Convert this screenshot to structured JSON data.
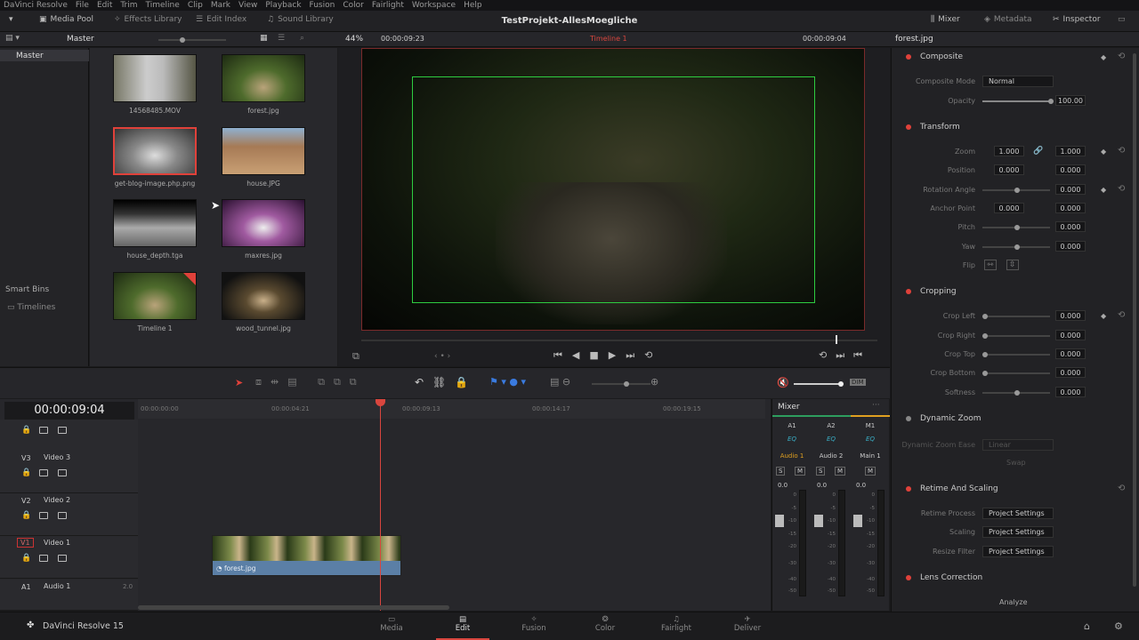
{
  "menu": [
    "DaVinci Resolve",
    "File",
    "Edit",
    "Trim",
    "Timeline",
    "Clip",
    "Mark",
    "View",
    "Playback",
    "Fusion",
    "Color",
    "Fairlight",
    "Workspace",
    "Help"
  ],
  "toolbar": {
    "media_pool": "Media Pool",
    "effects_library": "Effects Library",
    "edit_index": "Edit Index",
    "sound_library": "Sound Library",
    "project_title": "TestProjekt-AllesMoegliche",
    "mixer": "Mixer",
    "metadata": "Metadata",
    "inspector": "Inspector"
  },
  "subbar": {
    "bin": "Master",
    "zoom": "44%",
    "source_tc": "00:00:09:23",
    "timeline_name": "Timeline 1",
    "timeline_tc": "00:00:09:04",
    "clip_name": "forest.jpg"
  },
  "bins": {
    "master": "Master",
    "smart_bins": "Smart Bins",
    "timelines": "Timelines"
  },
  "clips": [
    {
      "name": "14568485.MOV"
    },
    {
      "name": "forest.jpg"
    },
    {
      "name": "get-blog-image.php.png",
      "selected": true
    },
    {
      "name": "house.JPG"
    },
    {
      "name": "house_depth.tga"
    },
    {
      "name": "maxres.jpg"
    },
    {
      "name": "Timeline 1"
    },
    {
      "name": "wood_tunnel.jpg"
    }
  ],
  "inspector": {
    "composite": {
      "title": "Composite",
      "mode_label": "Composite Mode",
      "mode": "Normal",
      "opacity_label": "Opacity",
      "opacity": "100.00",
      "opacity_fraction": 1.0
    },
    "transform": {
      "title": "Transform",
      "zoom_label": "Zoom",
      "zoom_x": "1.000",
      "zoom_y": "1.000",
      "position_label": "Position",
      "pos_x": "0.000",
      "pos_y": "0.000",
      "rotation_label": "Rotation Angle",
      "rotation": "0.000",
      "anchor_label": "Anchor Point",
      "anchor_x": "0.000",
      "anchor_y": "0.000",
      "pitch_label": "Pitch",
      "pitch": "0.000",
      "yaw_label": "Yaw",
      "yaw": "0.000",
      "flip_label": "Flip",
      "x": "X",
      "y": "Y"
    },
    "cropping": {
      "title": "Cropping",
      "rows": [
        {
          "label": "Crop Left",
          "value": "0.000"
        },
        {
          "label": "Crop Right",
          "value": "0.000"
        },
        {
          "label": "Crop Top",
          "value": "0.000"
        },
        {
          "label": "Crop Bottom",
          "value": "0.000"
        },
        {
          "label": "Softness",
          "value": "0.000"
        }
      ]
    },
    "dynamic_zoom": {
      "title": "Dynamic Zoom",
      "ease_label": "Dynamic Zoom Ease",
      "ease": "Linear",
      "swap": "Swap"
    },
    "retime": {
      "title": "Retime And Scaling",
      "process_label": "Retime Process",
      "process": "Project Settings",
      "scaling_label": "Scaling",
      "scaling": "Project Settings",
      "filter_label": "Resize Filter",
      "filter": "Project Settings"
    },
    "lens": {
      "title": "Lens Correction",
      "analyze": "Analyze"
    }
  },
  "timeline": {
    "timecode": "00:00:09:04",
    "ruler": [
      "00:00:00:00",
      "00:00:04:21",
      "00:00:09:13",
      "00:00:14:17",
      "00:00:19:15"
    ],
    "tracks": [
      {
        "id": "V3",
        "name": "Video 3"
      },
      {
        "id": "V2",
        "name": "Video 2"
      },
      {
        "id": "V1",
        "name": "Video 1"
      },
      {
        "id": "A1",
        "name": "Audio 1",
        "channels": "2.0"
      }
    ],
    "clip": "forest.jpg"
  },
  "mixer": {
    "title": "Mixer",
    "channels": [
      {
        "id": "A1",
        "name": "Audio 1",
        "level": "0.0"
      },
      {
        "id": "A2",
        "name": "Audio 2",
        "level": "0.0"
      },
      {
        "id": "M1",
        "name": "Main 1",
        "level": "0.0"
      }
    ],
    "eq": "EQ",
    "solo": "S",
    "mute": "M",
    "scale": [
      "0",
      "-5",
      "-10",
      "-15",
      "-20",
      "-30",
      "-40",
      "-50"
    ]
  },
  "pages": {
    "app": "DaVinci Resolve 15",
    "tabs": [
      "Media",
      "Edit",
      "Fusion",
      "Color",
      "Fairlight",
      "Deliver"
    ],
    "active": "Edit"
  },
  "colors": {
    "accent_red": "#e0413a",
    "timeline_red": "#d9463e",
    "clip_blue": "#5b7fa6",
    "transform_green": "#2ecc40"
  }
}
